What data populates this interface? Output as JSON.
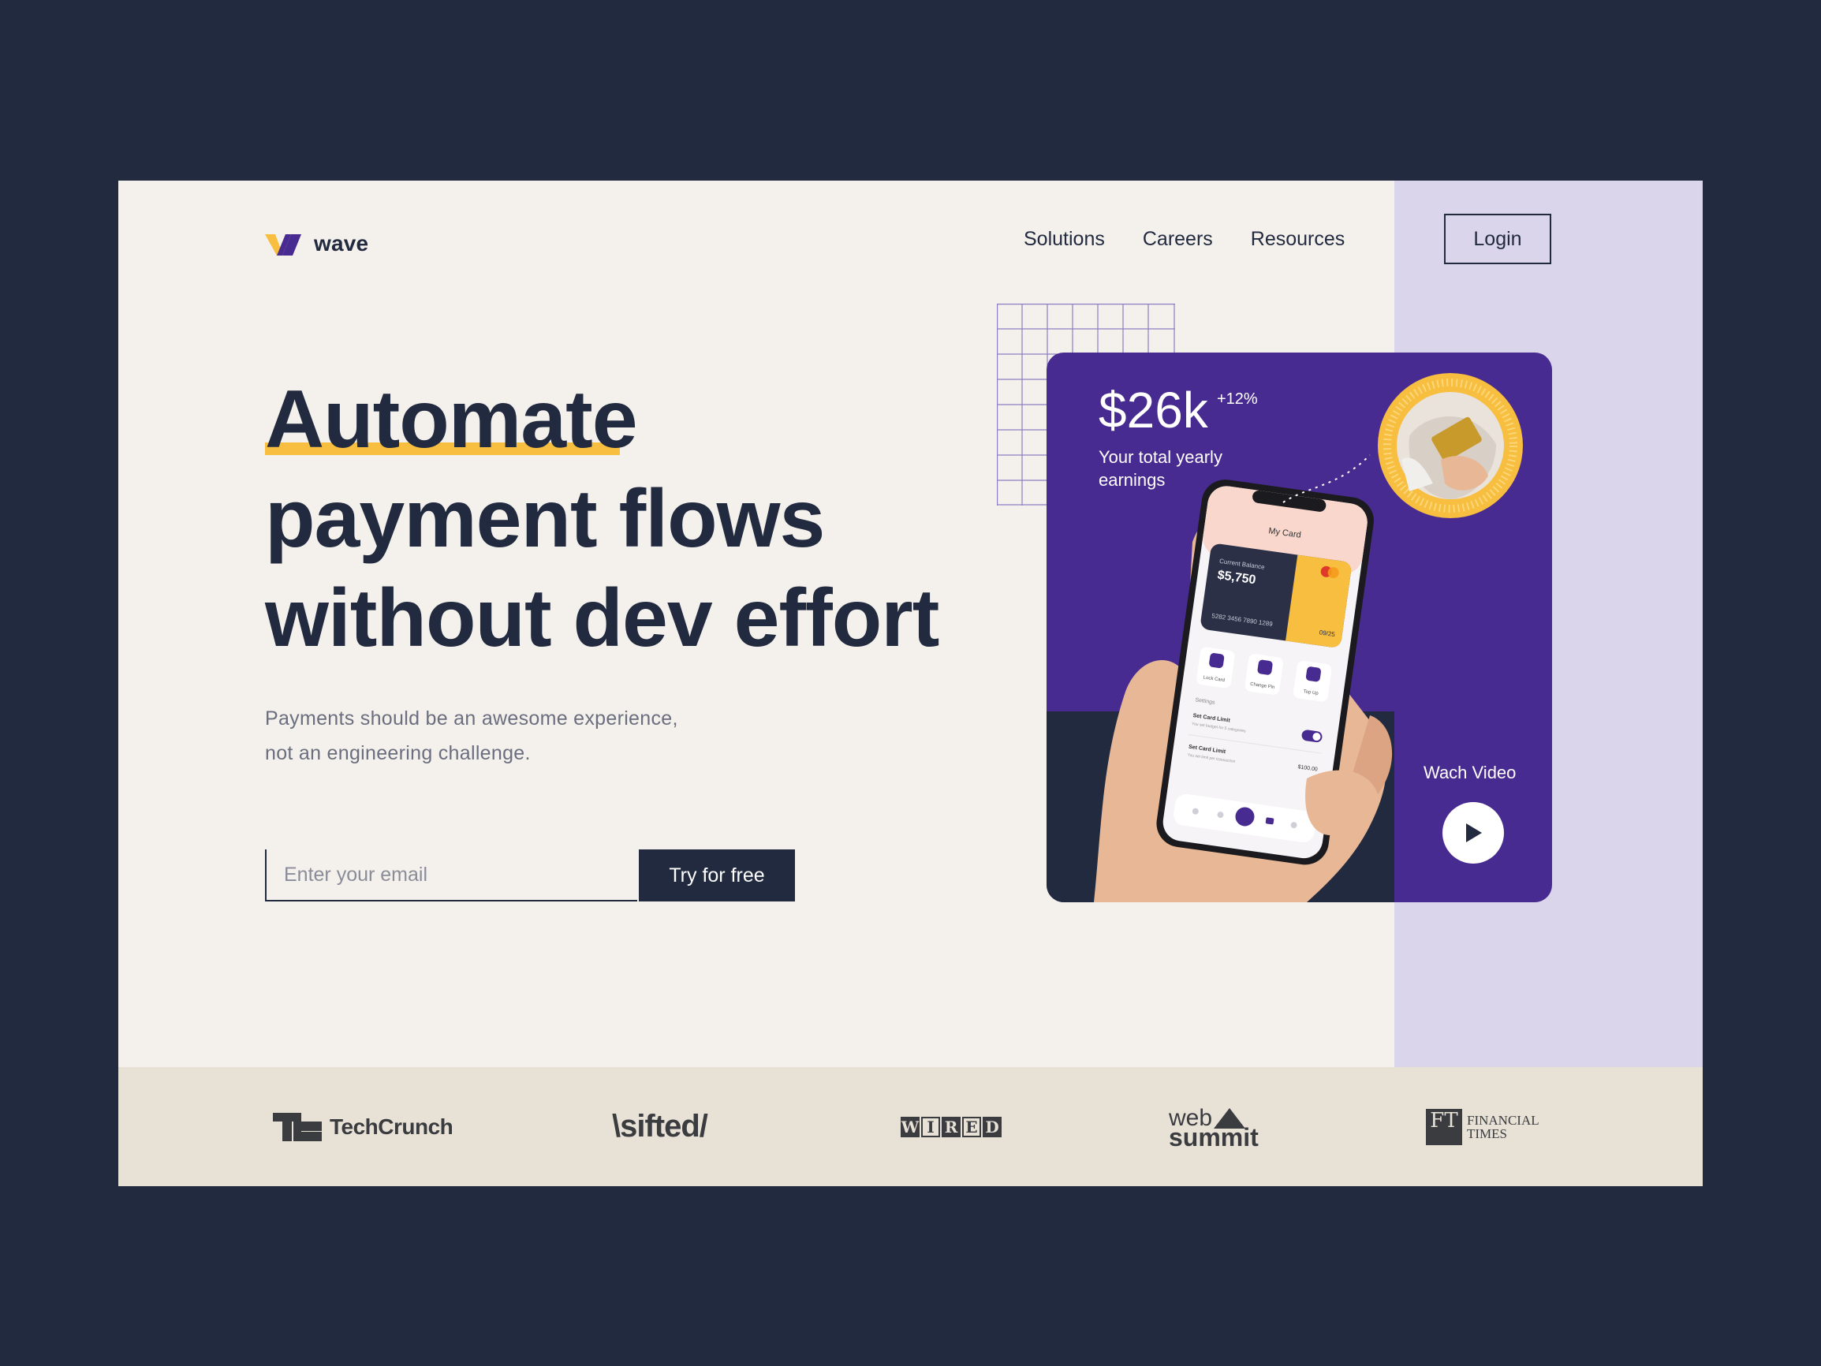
{
  "brand": {
    "name": "wave"
  },
  "nav": {
    "items": [
      "Solutions",
      "Careers",
      "Resources"
    ],
    "login_label": "Login"
  },
  "hero": {
    "headline_line1": "Automate",
    "headline_line2": "payment flows",
    "headline_line3": "without dev effort",
    "subtext_line1": "Payments should be an awesome experience,",
    "subtext_line2": "not an engineering challenge.",
    "email_placeholder": "Enter your email",
    "cta_label": "Try for free"
  },
  "card": {
    "amount": "$26k",
    "change": "+12%",
    "label": "Your total yearly earnings",
    "watch_label": "Wach Video",
    "phone": {
      "title": "My Card",
      "balance_label": "Current Balance",
      "balance": "$5,750",
      "card_number": "5282 3456 7890 1289",
      "expiry": "09/25",
      "actions": [
        "Lock Card",
        "Change Pin",
        "Top Up"
      ],
      "settings_label": "Settings",
      "setting1_title": "Set Card Limit",
      "setting1_sub": "You set budget for 5 categories",
      "setting2_title": "Set Card Limit",
      "setting2_sub": "You set limit per transaction",
      "setting2_value": "$100.00"
    }
  },
  "press": {
    "techcrunch": "TechCrunch",
    "sifted": "\\sifted/",
    "wired_letters": [
      "W",
      "I",
      "R",
      "E",
      "D"
    ],
    "websummit_top": "web",
    "websummit_bottom": "summit",
    "ft_mark": "FT",
    "ft_line1": "FINANCIAL",
    "ft_line2": "TIMES"
  },
  "colors": {
    "navy": "#222a3f",
    "cream": "#f4f1ec",
    "lavender": "#dad5ea",
    "purple": "#482b90",
    "yellow": "#f7be3f",
    "press_bg": "#e8e1d6"
  }
}
